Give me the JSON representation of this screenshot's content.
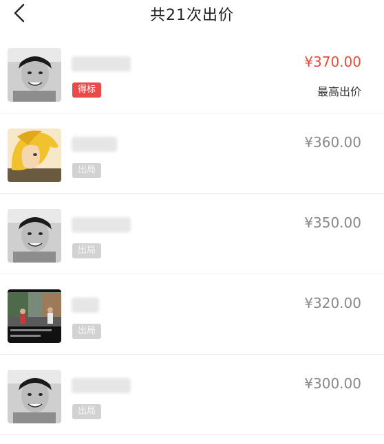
{
  "header": {
    "title": "共21次出价"
  },
  "bids": [
    {
      "price": "¥370.00",
      "tag": "得标",
      "note": "最高出价",
      "avatar": "smiling-man-avatar"
    },
    {
      "price": "¥360.00",
      "tag": "出局",
      "note": "",
      "avatar": "blonde-anime-avatar"
    },
    {
      "price": "¥350.00",
      "tag": "出局",
      "note": "",
      "avatar": "smiling-man-avatar"
    },
    {
      "price": "¥320.00",
      "tag": "出局",
      "note": "",
      "avatar": "street-photo-avatar"
    },
    {
      "price": "¥300.00",
      "tag": "出局",
      "note": "",
      "avatar": "smiling-man-avatar"
    }
  ],
  "colors": {
    "top_price": "#e64a3b",
    "win_tag": "#e94b4b",
    "out_tag": "#d2d2d2"
  }
}
